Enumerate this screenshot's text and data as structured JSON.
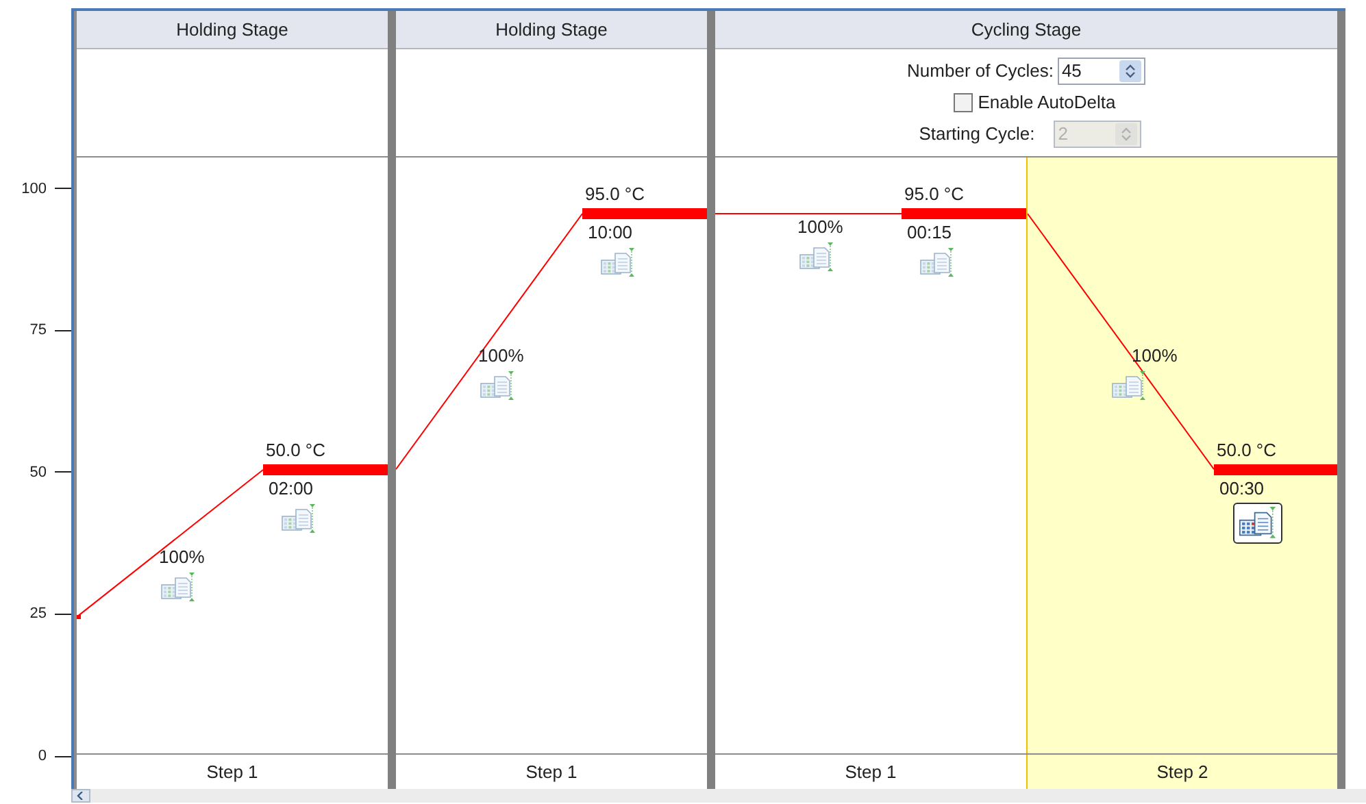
{
  "stages": [
    {
      "title": "Holding Stage",
      "steps": [
        {
          "label": "Step 1",
          "ramp": "100%",
          "temperature": "50.0 °C",
          "time": "02:00",
          "level": 0.476,
          "selected": false
        }
      ]
    },
    {
      "title": "Holding Stage",
      "steps": [
        {
          "label": "Step 1",
          "ramp": "100%",
          "temperature": "95.0 °C",
          "time": "10:00",
          "level": 0.905,
          "selected": false
        }
      ]
    },
    {
      "title": "Cycling Stage",
      "cycles": {
        "label": "Number of Cycles:",
        "value": "45"
      },
      "auto_delta": {
        "label": "Enable AutoDelta",
        "checked": false
      },
      "starting_cycle": {
        "label": "Starting Cycle:",
        "value": "2",
        "disabled": true
      },
      "steps": [
        {
          "label": "Step 1",
          "ramp": "100%",
          "temperature": "95.0 °C",
          "time": "00:15",
          "level": 0.905,
          "selected": false
        },
        {
          "label": "Step 2",
          "ramp": "100%",
          "temperature": "50.0 °C",
          "time": "00:30",
          "level": 0.476,
          "selected": true
        }
      ]
    }
  ],
  "profile": {
    "start": {
      "level": 0.229
    },
    "y_axis": {
      "ticks": [
        "100",
        "75",
        "50",
        "25",
        "0"
      ]
    }
  }
}
